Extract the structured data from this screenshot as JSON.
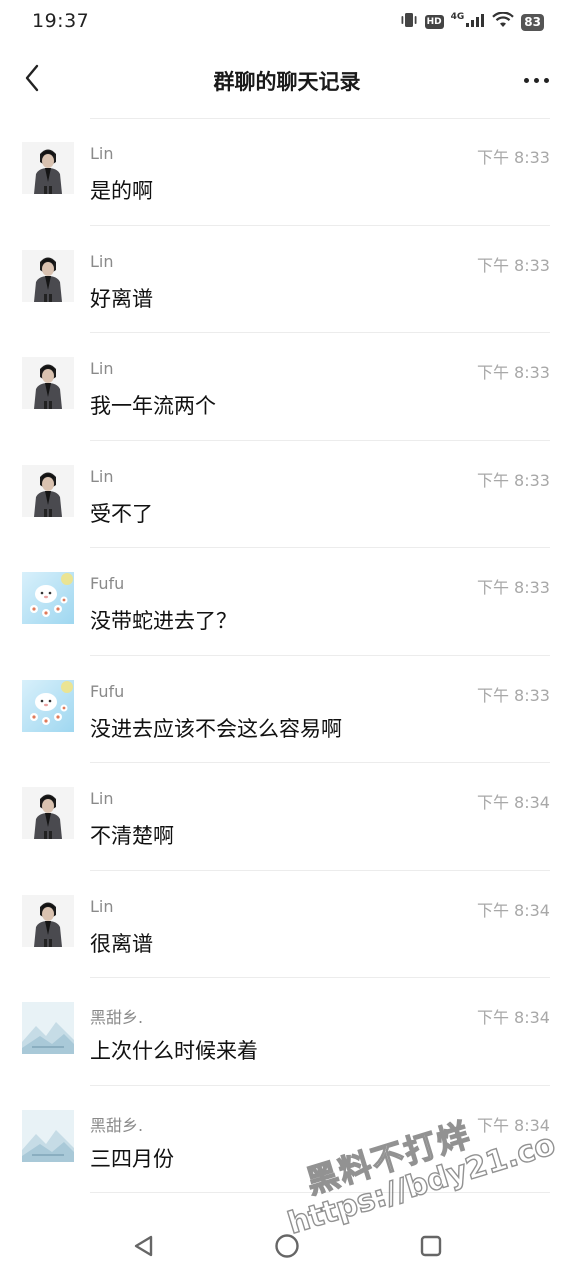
{
  "status_bar": {
    "time": "19:37",
    "network": "4G",
    "hd": "HD",
    "battery": "83"
  },
  "header": {
    "title": "群聊的聊天记录",
    "back_icon": "chevron-left-icon",
    "more_icon": "more-horizontal-icon"
  },
  "messages": [
    {
      "sender": "Lin",
      "time": "下午 8:33",
      "text": "是的啊",
      "avatar": "lin"
    },
    {
      "sender": "Lin",
      "time": "下午 8:33",
      "text": "好离谱",
      "avatar": "lin"
    },
    {
      "sender": "Lin",
      "time": "下午 8:33",
      "text": "我一年流两个",
      "avatar": "lin"
    },
    {
      "sender": "Lin",
      "time": "下午 8:33",
      "text": "受不了",
      "avatar": "lin"
    },
    {
      "sender": "Fufu",
      "time": "下午 8:33",
      "text": "没带蛇进去了？",
      "avatar": "fufu"
    },
    {
      "sender": "Fufu",
      "time": "下午 8:33",
      "text": "没进去应该不会这么容易啊",
      "avatar": "fufu"
    },
    {
      "sender": "Lin",
      "time": "下午 8:34",
      "text": "不清楚啊",
      "avatar": "lin"
    },
    {
      "sender": "Lin",
      "time": "下午 8:34",
      "text": "很离谱",
      "avatar": "lin"
    },
    {
      "sender": "黑甜乡.",
      "time": "下午 8:34",
      "text": "上次什么时候来着",
      "avatar": "heitian"
    },
    {
      "sender": "黑甜乡.",
      "time": "下午 8:34",
      "text": "三四月份",
      "avatar": "heitian"
    }
  ],
  "watermark": {
    "line1": "黑料不打烊",
    "line2": "https://bdy21.co"
  },
  "bottom_nav": {
    "back_icon": "triangle-back-icon",
    "home_icon": "circle-home-icon",
    "recents_icon": "square-recents-icon"
  }
}
